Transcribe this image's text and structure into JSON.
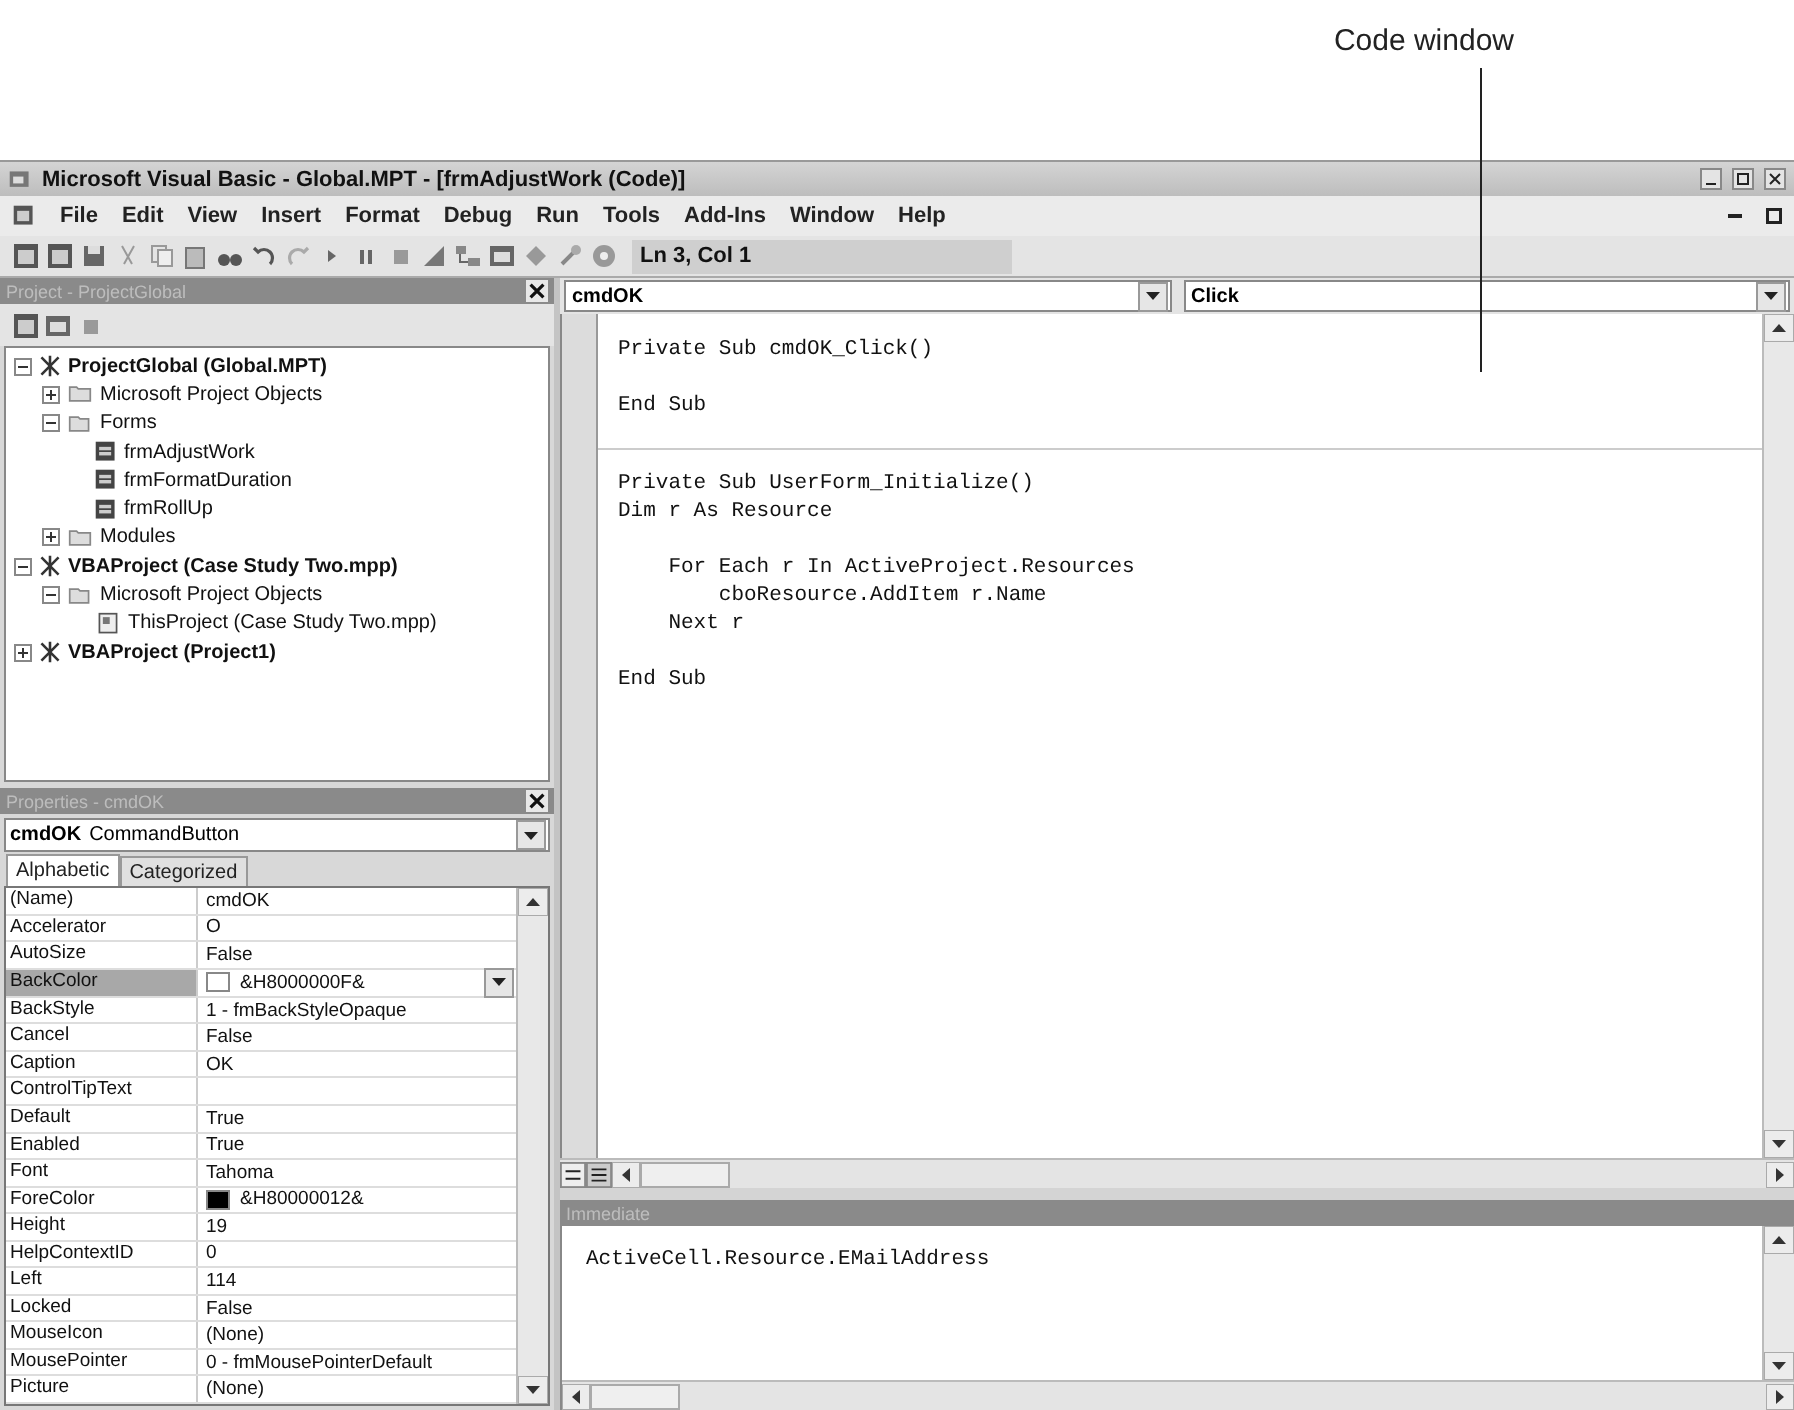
{
  "callout": {
    "label": "Code window"
  },
  "window": {
    "title": "Microsoft Visual Basic - Global.MPT - [frmAdjustWork (Code)]"
  },
  "menu": [
    "File",
    "Edit",
    "View",
    "Insert",
    "Format",
    "Debug",
    "Run",
    "Tools",
    "Add-Ins",
    "Window",
    "Help"
  ],
  "toolbar": {
    "position": "Ln 3, Col 1"
  },
  "project_pane": {
    "title": "Project - ProjectGlobal",
    "tree": [
      {
        "label": "ProjectGlobal (Global.MPT)",
        "kind": "project",
        "expanded": true,
        "children": [
          {
            "label": "Microsoft Project Objects",
            "kind": "folder",
            "expanded": false
          },
          {
            "label": "Forms",
            "kind": "folder",
            "expanded": true,
            "children": [
              {
                "label": "frmAdjustWork",
                "kind": "form"
              },
              {
                "label": "frmFormatDuration",
                "kind": "form"
              },
              {
                "label": "frmRollUp",
                "kind": "form"
              }
            ]
          },
          {
            "label": "Modules",
            "kind": "folder",
            "expanded": false
          }
        ]
      },
      {
        "label": "VBAProject (Case Study Two.mpp)",
        "kind": "project",
        "expanded": true,
        "children": [
          {
            "label": "Microsoft Project Objects",
            "kind": "folder",
            "expanded": true,
            "children": [
              {
                "label": "ThisProject (Case Study Two.mpp)",
                "kind": "document"
              }
            ]
          }
        ]
      },
      {
        "label": "VBAProject (Project1)",
        "kind": "project",
        "expanded": false
      }
    ]
  },
  "properties_pane": {
    "title": "Properties - cmdOK",
    "object_name": "cmdOK",
    "object_type": "CommandButton",
    "tabs": [
      {
        "label": "Alphabetic",
        "selected": true
      },
      {
        "label": "Categorized",
        "selected": false
      }
    ],
    "rows": [
      {
        "name": "(Name)",
        "value": "cmdOK",
        "selected": false
      },
      {
        "name": "Accelerator",
        "value": "O",
        "selected": false
      },
      {
        "name": "AutoSize",
        "value": "False",
        "selected": false
      },
      {
        "name": "BackColor",
        "value": "&H8000000F&",
        "color": "#ffffff",
        "selected": true
      },
      {
        "name": "BackStyle",
        "value": "1 - fmBackStyleOpaque",
        "selected": false
      },
      {
        "name": "Cancel",
        "value": "False",
        "selected": false
      },
      {
        "name": "Caption",
        "value": "OK",
        "selected": false
      },
      {
        "name": "ControlTipText",
        "selected": false
      },
      {
        "name": "Default",
        "value": "True",
        "selected": false
      },
      {
        "name": "Enabled",
        "value": "True",
        "selected": false
      },
      {
        "name": "Font",
        "value": "Tahoma",
        "selected": false
      },
      {
        "name": "ForeColor",
        "value": "&H80000012&",
        "color": "#000000",
        "selected": false
      },
      {
        "name": "Height",
        "value": "19",
        "selected": false
      },
      {
        "name": "HelpContextID",
        "value": "0",
        "selected": false
      },
      {
        "name": "Left",
        "value": "114",
        "selected": false
      },
      {
        "name": "Locked",
        "value": "False",
        "selected": false
      },
      {
        "name": "MouseIcon",
        "value": "(None)",
        "selected": false
      },
      {
        "name": "MousePointer",
        "value": "0 - fmMousePointerDefault",
        "selected": false
      },
      {
        "name": "Picture",
        "value": "(None)",
        "selected": false
      }
    ]
  },
  "code_pane": {
    "object": "cmdOK",
    "procedure": "Click",
    "procedures": [
      {
        "blocks": [
          [
            "Private Sub cmdOK_Click()"
          ],
          [
            "End Sub"
          ]
        ]
      },
      {
        "blocks": [
          [
            "Private Sub UserForm_Initialize()",
            "Dim r As Resource"
          ],
          [
            "    For Each r In ActiveProject.Resources",
            "        cboResource.AddItem r.Name",
            "    Next r"
          ],
          [
            "End Sub"
          ]
        ]
      }
    ]
  },
  "immediate_pane": {
    "title": "Immediate",
    "lines": [
      "ActiveCell.Resource.EMailAddress"
    ]
  }
}
